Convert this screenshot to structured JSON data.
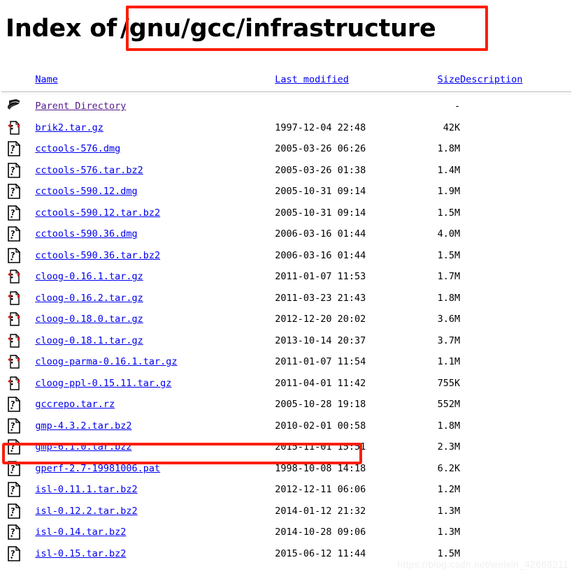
{
  "header": {
    "title_prefix": "Index of",
    "path": "/gnu/gcc/infrastructure",
    "highlight_color": "#fb1e08"
  },
  "columns": {
    "name": "Name",
    "last_modified": "Last modified",
    "size": "Size",
    "description": "Description"
  },
  "link_color": "#0000ee",
  "visited_link_color": "#551a8b",
  "rows": [
    {
      "icon": "back-arrow-icon",
      "name": "Parent Directory",
      "date": "",
      "size": "-",
      "desc": "",
      "visited": true,
      "highlighted": false
    },
    {
      "icon": "compressed-icon",
      "name": "brik2.tar.gz",
      "date": "1997-12-04 22:48",
      "size": "42K",
      "desc": "",
      "visited": false,
      "highlighted": false
    },
    {
      "icon": "unknown-file-icon",
      "name": "cctools-576.dmg",
      "date": "2005-03-26 06:26",
      "size": "1.8M",
      "desc": "",
      "visited": false,
      "highlighted": false
    },
    {
      "icon": "unknown-file-icon",
      "name": "cctools-576.tar.bz2",
      "date": "2005-03-26 01:38",
      "size": "1.4M",
      "desc": "",
      "visited": false,
      "highlighted": false
    },
    {
      "icon": "unknown-file-icon",
      "name": "cctools-590.12.dmg",
      "date": "2005-10-31 09:14",
      "size": "1.9M",
      "desc": "",
      "visited": false,
      "highlighted": false
    },
    {
      "icon": "unknown-file-icon",
      "name": "cctools-590.12.tar.bz2",
      "date": "2005-10-31 09:14",
      "size": "1.5M",
      "desc": "",
      "visited": false,
      "highlighted": false
    },
    {
      "icon": "unknown-file-icon",
      "name": "cctools-590.36.dmg",
      "date": "2006-03-16 01:44",
      "size": "4.0M",
      "desc": "",
      "visited": false,
      "highlighted": false
    },
    {
      "icon": "unknown-file-icon",
      "name": "cctools-590.36.tar.bz2",
      "date": "2006-03-16 01:44",
      "size": "1.5M",
      "desc": "",
      "visited": false,
      "highlighted": false
    },
    {
      "icon": "compressed-icon",
      "name": "cloog-0.16.1.tar.gz",
      "date": "2011-01-07 11:53",
      "size": "1.7M",
      "desc": "",
      "visited": false,
      "highlighted": false
    },
    {
      "icon": "compressed-icon",
      "name": "cloog-0.16.2.tar.gz",
      "date": "2011-03-23 21:43",
      "size": "1.8M",
      "desc": "",
      "visited": false,
      "highlighted": false
    },
    {
      "icon": "compressed-icon",
      "name": "cloog-0.18.0.tar.gz",
      "date": "2012-12-20 20:02",
      "size": "3.6M",
      "desc": "",
      "visited": false,
      "highlighted": false
    },
    {
      "icon": "compressed-icon",
      "name": "cloog-0.18.1.tar.gz",
      "date": "2013-10-14 20:37",
      "size": "3.7M",
      "desc": "",
      "visited": false,
      "highlighted": false
    },
    {
      "icon": "compressed-icon",
      "name": "cloog-parma-0.16.1.tar.gz",
      "date": "2011-01-07 11:54",
      "size": "1.1M",
      "desc": "",
      "visited": false,
      "highlighted": false
    },
    {
      "icon": "compressed-icon",
      "name": "cloog-ppl-0.15.11.tar.gz",
      "date": "2011-04-01 11:42",
      "size": "755K",
      "desc": "",
      "visited": false,
      "highlighted": false
    },
    {
      "icon": "unknown-file-icon",
      "name": "gccrepo.tar.rz",
      "date": "2005-10-28 19:18",
      "size": "552M",
      "desc": "",
      "visited": false,
      "highlighted": false
    },
    {
      "icon": "unknown-file-icon",
      "name": "gmp-4.3.2.tar.bz2",
      "date": "2010-02-01 00:58",
      "size": "1.8M",
      "desc": "",
      "visited": false,
      "highlighted": false
    },
    {
      "icon": "unknown-file-icon",
      "name": "gmp-6.1.0.tar.bz2",
      "date": "2015-11-01 15:51",
      "size": "2.3M",
      "desc": "",
      "visited": false,
      "highlighted": true
    },
    {
      "icon": "unknown-file-icon",
      "name": "gperf-2.7-19981006.pat",
      "date": "1998-10-08 14:18",
      "size": "6.2K",
      "desc": "",
      "visited": false,
      "highlighted": false
    },
    {
      "icon": "unknown-file-icon",
      "name": "isl-0.11.1.tar.bz2",
      "date": "2012-12-11 06:06",
      "size": "1.2M",
      "desc": "",
      "visited": false,
      "highlighted": false
    },
    {
      "icon": "unknown-file-icon",
      "name": "isl-0.12.2.tar.bz2",
      "date": "2014-01-12 21:32",
      "size": "1.3M",
      "desc": "",
      "visited": false,
      "highlighted": false
    },
    {
      "icon": "unknown-file-icon",
      "name": "isl-0.14.tar.bz2",
      "date": "2014-10-28 09:06",
      "size": "1.3M",
      "desc": "",
      "visited": false,
      "highlighted": false
    },
    {
      "icon": "unknown-file-icon",
      "name": "isl-0.15.tar.bz2",
      "date": "2015-06-12 11:44",
      "size": "1.5M",
      "desc": "",
      "visited": false,
      "highlighted": false
    }
  ],
  "watermark": "https://blog.csdn.net/weixin_42668211"
}
